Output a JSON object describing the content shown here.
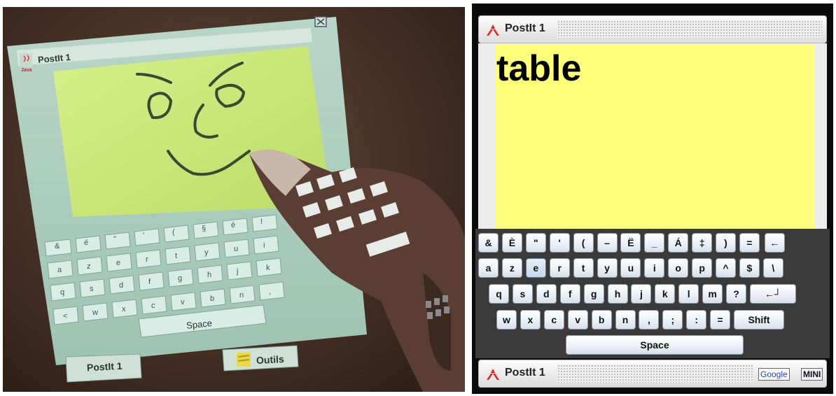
{
  "photo": {
    "window_title": "PostIt 1",
    "java_label": "Java",
    "bottom_title": "PostIt 1",
    "tools_label": "Outils",
    "space_label": "Space",
    "rows": [
      [
        "&",
        "é",
        "\"",
        "'",
        "(",
        "§",
        "è",
        "!",
        "ç"
      ],
      [
        "a",
        "z",
        "e",
        "r",
        "t",
        "y",
        "u",
        "i"
      ],
      [
        "q",
        "s",
        "d",
        "f",
        "g",
        "h",
        "j",
        "k"
      ],
      [
        "<",
        "w",
        "x",
        "c",
        "v",
        "b",
        "n",
        ","
      ]
    ]
  },
  "screen": {
    "top_title": "PostIt 1",
    "note_text": "table",
    "bottom_title": "PostIt 1",
    "google_label": "Google",
    "mini_label": "MINI",
    "keyboard": {
      "rows": [
        [
          "&",
          "È",
          "\"",
          "'",
          "(",
          "–",
          "Ë",
          "_",
          "Á",
          "‡",
          ")",
          "=",
          "←"
        ],
        [
          "a",
          "z",
          "e",
          "r",
          "t",
          "y",
          "u",
          "i",
          "o",
          "p",
          "^",
          "$",
          "\\"
        ],
        [
          "q",
          "s",
          "d",
          "f",
          "g",
          "h",
          "j",
          "k",
          "l",
          "m",
          "?",
          "←┘"
        ],
        [
          "w",
          "x",
          "c",
          "v",
          "b",
          "n",
          ",",
          ";",
          ":",
          "=",
          "Shift"
        ],
        [
          "Space"
        ]
      ],
      "selected_key": "e"
    },
    "colors": {
      "note": "#ffff7c",
      "logo": "#e0201a",
      "keyboard_bg": "#3a3a3a"
    }
  }
}
